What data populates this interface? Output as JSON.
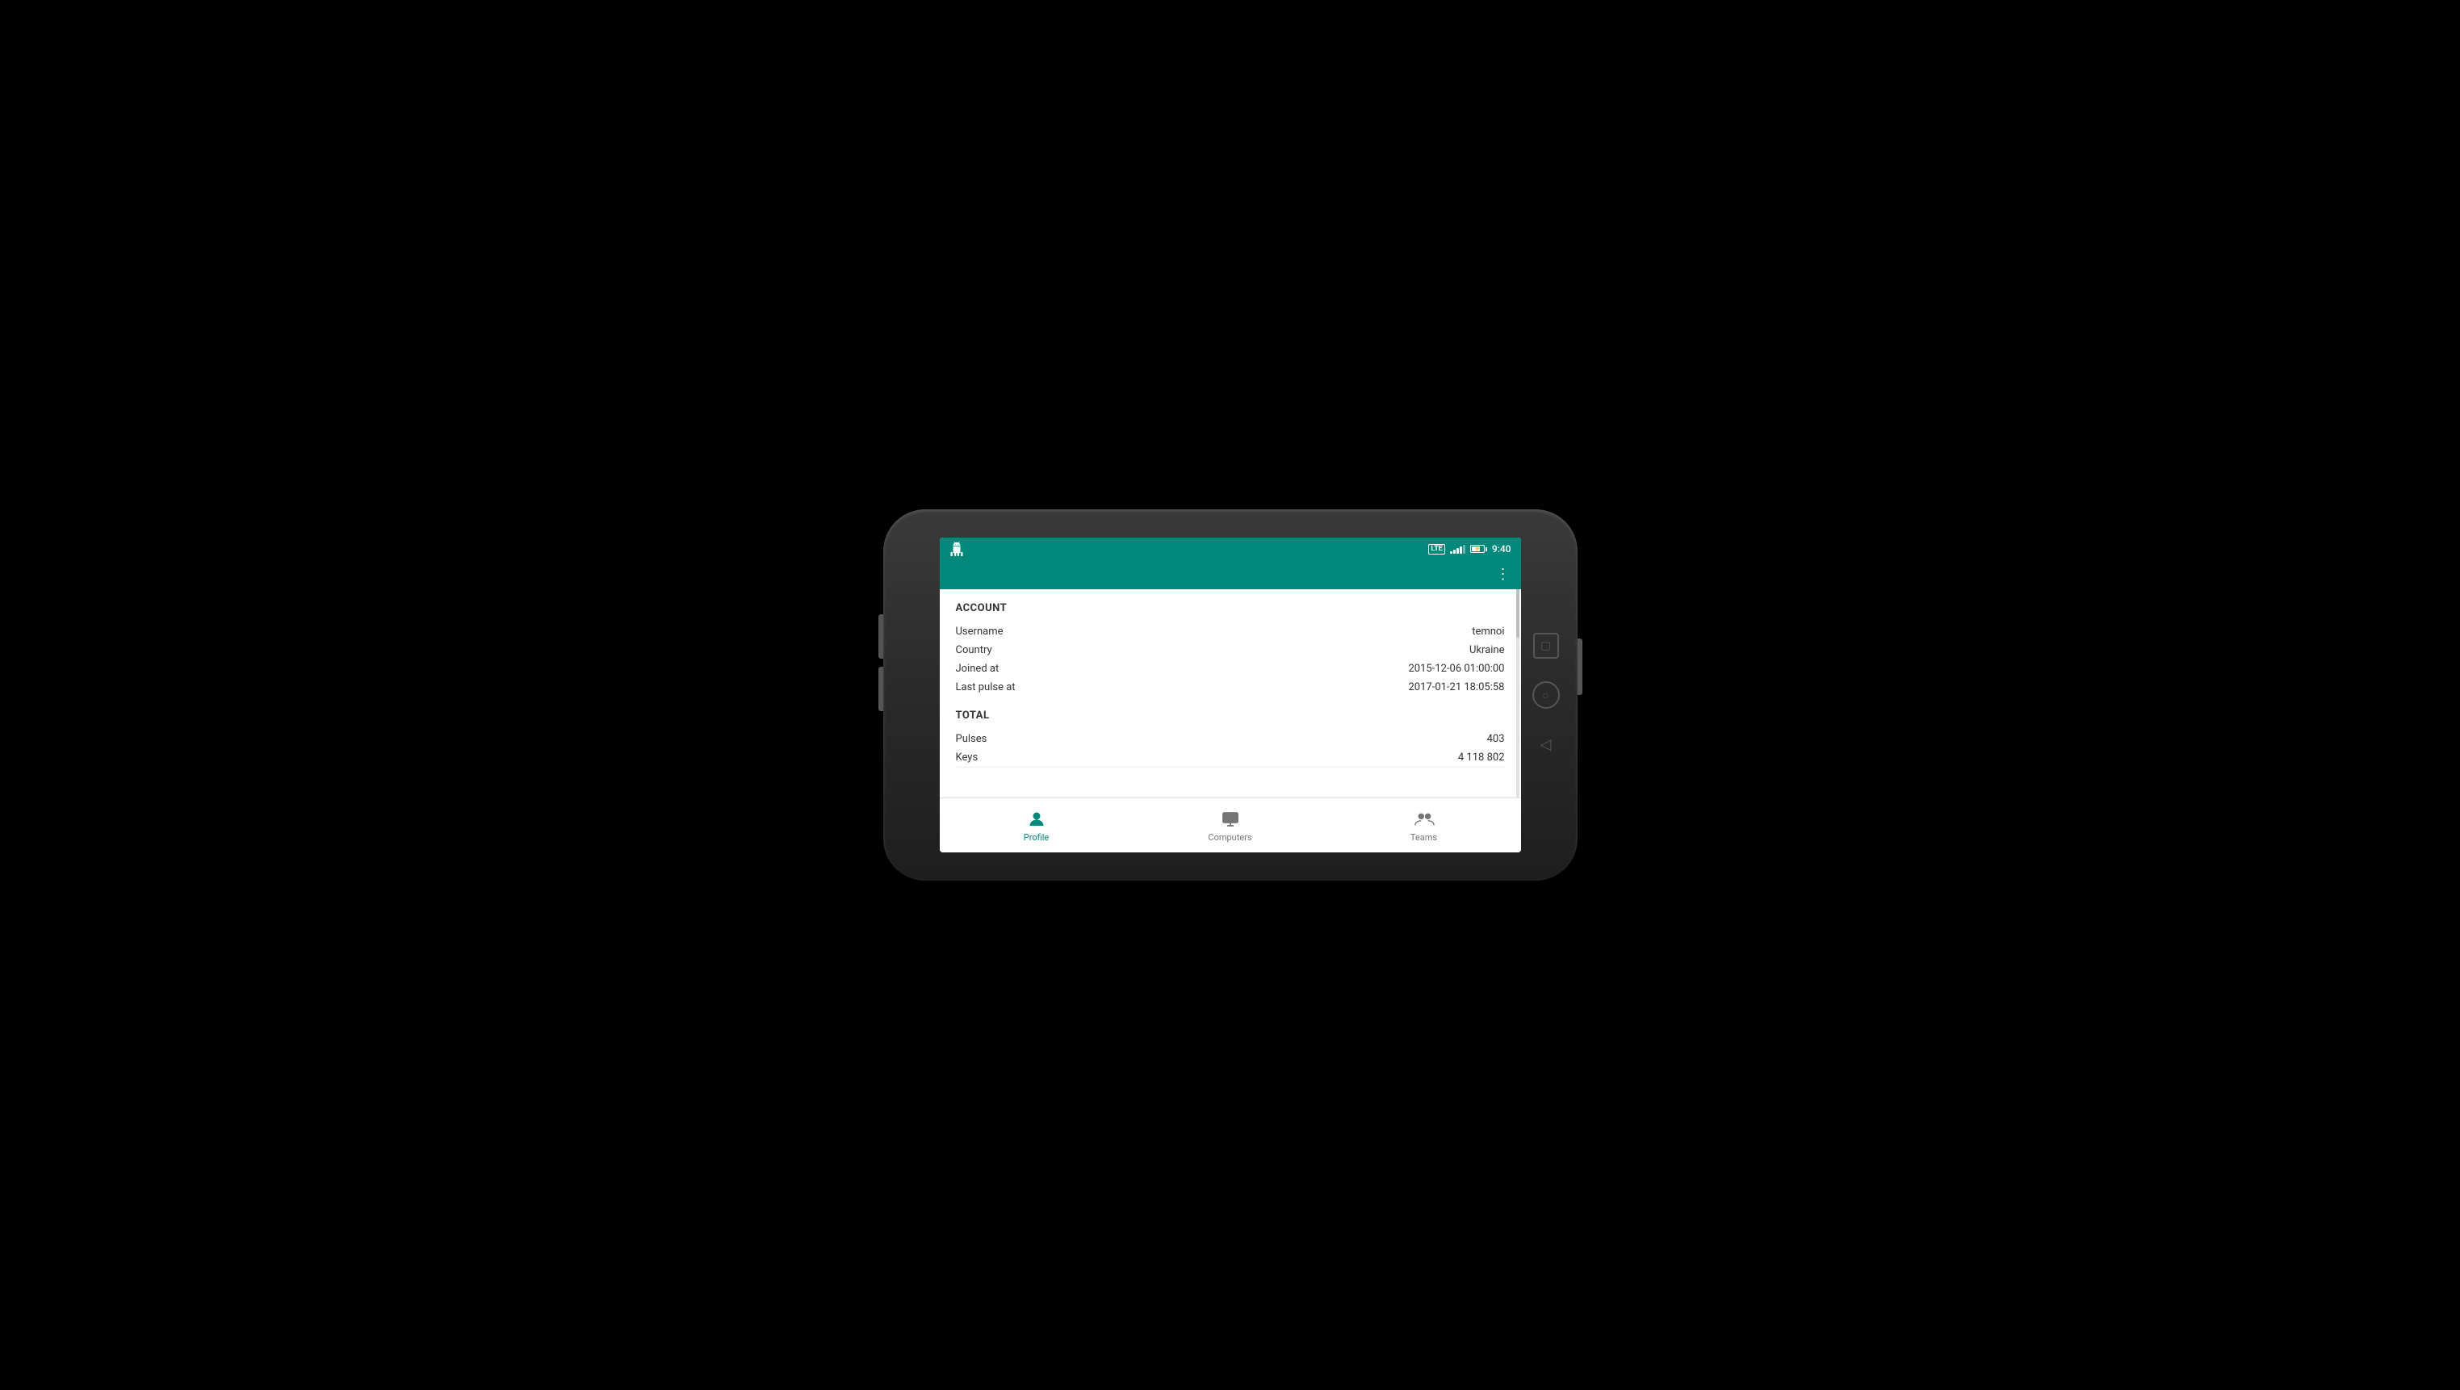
{
  "statusBar": {
    "time": "9:40",
    "lte": "LTE"
  },
  "account": {
    "sectionTitle": "ACCOUNT",
    "fields": [
      {
        "label": "Username",
        "value": "temnoi"
      },
      {
        "label": "Country",
        "value": "Ukraine"
      },
      {
        "label": "Joined at",
        "value": "2015-12-06 01:00:00"
      },
      {
        "label": "Last pulse at",
        "value": "2017-01-21 18:05:58"
      }
    ]
  },
  "total": {
    "sectionTitle": "TOTAL",
    "fields": [
      {
        "label": "Pulses",
        "value": "403"
      },
      {
        "label": "Keys",
        "value": "4 118 802"
      }
    ]
  },
  "bottomNav": {
    "items": [
      {
        "id": "profile",
        "label": "Profile",
        "active": true
      },
      {
        "id": "computers",
        "label": "Computers",
        "active": false
      },
      {
        "id": "teams",
        "label": "Teams",
        "active": false
      }
    ]
  },
  "menu": {
    "dotsSymbol": "⋮"
  }
}
